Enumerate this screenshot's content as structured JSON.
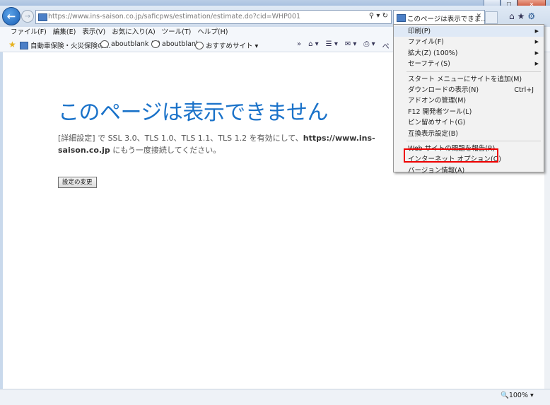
{
  "browser": {
    "address_url": "https://www.ins-saison.co.jp/saficpws/estimation/estimate.do?cid=WHP001",
    "tab_title": "このページは表示できま...",
    "address_icons": "⚲ ▾ ↻"
  },
  "menubar": [
    "ファイル(F)",
    "編集(E)",
    "表示(V)",
    "お気に入り(A)",
    "ツール(T)",
    "ヘルプ(H)"
  ],
  "favorites": [
    {
      "label": "自動車保険・火災保険の...",
      "icon": "site"
    },
    {
      "label": "aboutblank (2)",
      "icon": "ie"
    },
    {
      "label": "aboutblank",
      "icon": "ie"
    },
    {
      "label": "おすすめサイト ▾",
      "icon": "ie"
    }
  ],
  "commandbar": {
    "home": "⌂ ▾",
    "feeds": "☰ ▾",
    "mail": "✉ ▾",
    "print": "⎙ ▾",
    "page": "ペ"
  },
  "page": {
    "title": "このページは表示できません",
    "body_prefix": "[詳細設定] で SSL 3.0、TLS 1.0、TLS 1.1、TLS 1.2 を有効にして、",
    "body_url": "https://www.ins-saison.co.jp",
    "body_suffix": " にもう一度接続してください。",
    "settings_button": "設定の変更"
  },
  "status": {
    "zoom": "🔍100% ▾"
  },
  "tools_menu": {
    "items": [
      {
        "label": "印刷(P)",
        "submenu": true,
        "highlight": true
      },
      {
        "label": "ファイル(F)",
        "submenu": true
      },
      {
        "label": "拡大(Z) (100%)",
        "submenu": true
      },
      {
        "label": "セーフティ(S)",
        "submenu": true
      },
      {
        "separator": true
      },
      {
        "label": "スタート メニューにサイトを追加(M)"
      },
      {
        "label": "ダウンロードの表示(N)",
        "shortcut": "Ctrl+J"
      },
      {
        "label": "アドオンの管理(M)"
      },
      {
        "label": "F12 開発者ツール(L)"
      },
      {
        "label": "ピン留めサイト(G)"
      },
      {
        "label": "互換表示設定(B)"
      },
      {
        "separator": true
      },
      {
        "label": "Web サイトの問題を報告(R)"
      },
      {
        "label": "インターネット オプション(O)",
        "boxed": true
      },
      {
        "label": "バージョン情報(A)"
      }
    ]
  },
  "colors": {
    "title_blue": "#1a72c9",
    "highlight_red": "#ee0000",
    "menu_bg": "#f2f2f2"
  }
}
